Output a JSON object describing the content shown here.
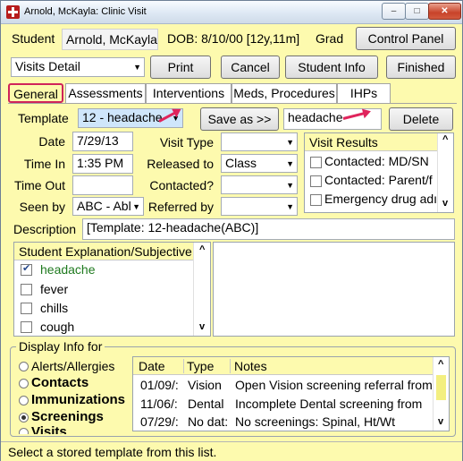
{
  "window": {
    "title": "Arnold, McKayla: Clinic Visit",
    "controls": {
      "minimize": "–",
      "maximize": "□",
      "close": "✕"
    }
  },
  "header": {
    "student_label": "Student",
    "student_name": "Arnold, McKayla",
    "dob_text": "DOB: 8/10/00 [12y,11m]",
    "grade_label": "Grad",
    "control_panel": "Control Panel"
  },
  "toolbar": {
    "view_select": "Visits Detail",
    "print": "Print",
    "cancel": "Cancel",
    "student_info": "Student Info",
    "finished": "Finished"
  },
  "tabs": [
    {
      "label": "General"
    },
    {
      "label": "Assessments"
    },
    {
      "label": "Interventions"
    },
    {
      "label": "Meds, Procedures"
    },
    {
      "label": "IHPs"
    }
  ],
  "template_row": {
    "label": "Template",
    "value": "12 - headache",
    "save_as": "Save as >>",
    "name_value": "headache",
    "delete": "Delete"
  },
  "form": {
    "date_label": "Date",
    "date_value": "7/29/13",
    "time_in_label": "Time In",
    "time_in_value": "1:35 PM",
    "time_out_label": "Time Out",
    "time_out_value": "",
    "seen_by_label": "Seen by",
    "seen_by_value": "ABC - Abl",
    "visit_type_label": "Visit Type",
    "visit_type_value": "",
    "released_to_label": "Released to",
    "released_to_value": "Class",
    "contacted_label": "Contacted?",
    "contacted_value": "",
    "referred_by_label": "Referred by",
    "referred_by_value": "",
    "description_label": "Description",
    "description_value": "[Template: 12-headache(ABC)]"
  },
  "visit_results": {
    "title": "Visit Results",
    "items": [
      {
        "label": "Contacted: MD/SN",
        "checked": false
      },
      {
        "label": "Contacted: Parent/f",
        "checked": false
      },
      {
        "label": "Emergency drug adı",
        "checked": false
      }
    ]
  },
  "explanation": {
    "title": "Student Explanation/Subjective",
    "items": [
      {
        "label": "headache",
        "checked": true
      },
      {
        "label": "fever",
        "checked": false
      },
      {
        "label": "chills",
        "checked": false
      },
      {
        "label": "cough",
        "checked": false
      }
    ]
  },
  "display_info": {
    "title": "Display Info for",
    "options": [
      {
        "label": "Alerts/Allergies",
        "selected": false,
        "bold": false
      },
      {
        "label": "Contacts",
        "selected": false,
        "bold": true
      },
      {
        "label": "Immunizations",
        "selected": false,
        "bold": true
      },
      {
        "label": "Screenings",
        "selected": true,
        "bold": true
      },
      {
        "label": "Visits",
        "selected": false,
        "bold": true
      }
    ],
    "columns": [
      "Date",
      "Type",
      "Notes"
    ],
    "rows": [
      [
        "01/09/:",
        "Vision",
        "Open Vision screening referral from"
      ],
      [
        "11/06/:",
        "Dental",
        "Incomplete Dental screening from"
      ],
      [
        "07/29/:",
        "No dat:",
        "No screenings: Spinal, Ht/Wt"
      ]
    ]
  },
  "status_bar": {
    "text": "Select a stored template from this list."
  },
  "colors": {
    "window_bg": "#fdfaae",
    "highlight": "#cfe6fb",
    "annotation": "#e0245c",
    "checked_text": "#1f7a1f"
  }
}
